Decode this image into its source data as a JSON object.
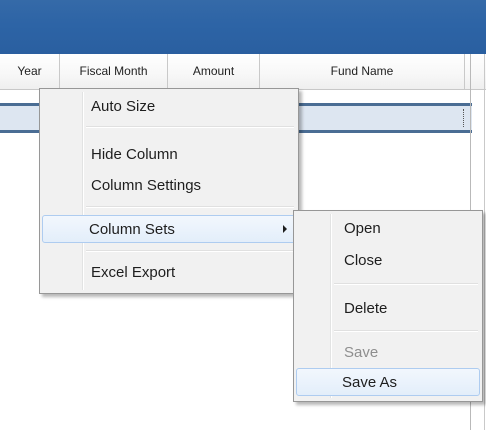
{
  "grid": {
    "columns": [
      {
        "label": "Year"
      },
      {
        "label": "Fiscal Month"
      },
      {
        "label": "Amount"
      },
      {
        "label": "Fund Name"
      }
    ]
  },
  "context_menu": {
    "items": [
      {
        "label": "Auto Size"
      },
      {
        "label": "Hide Column"
      },
      {
        "label": "Column Settings"
      },
      {
        "label": "Column Sets"
      },
      {
        "label": "Excel Export"
      }
    ]
  },
  "submenu": {
    "items": [
      {
        "label": "Open"
      },
      {
        "label": "Close"
      },
      {
        "label": "Delete"
      },
      {
        "label": "Save",
        "disabled": true
      },
      {
        "label": "Save As"
      }
    ]
  },
  "colors": {
    "title_bar": "#2d64a6",
    "highlight_border": "#aeccf0",
    "filter_row_border": "#4a6d94"
  }
}
